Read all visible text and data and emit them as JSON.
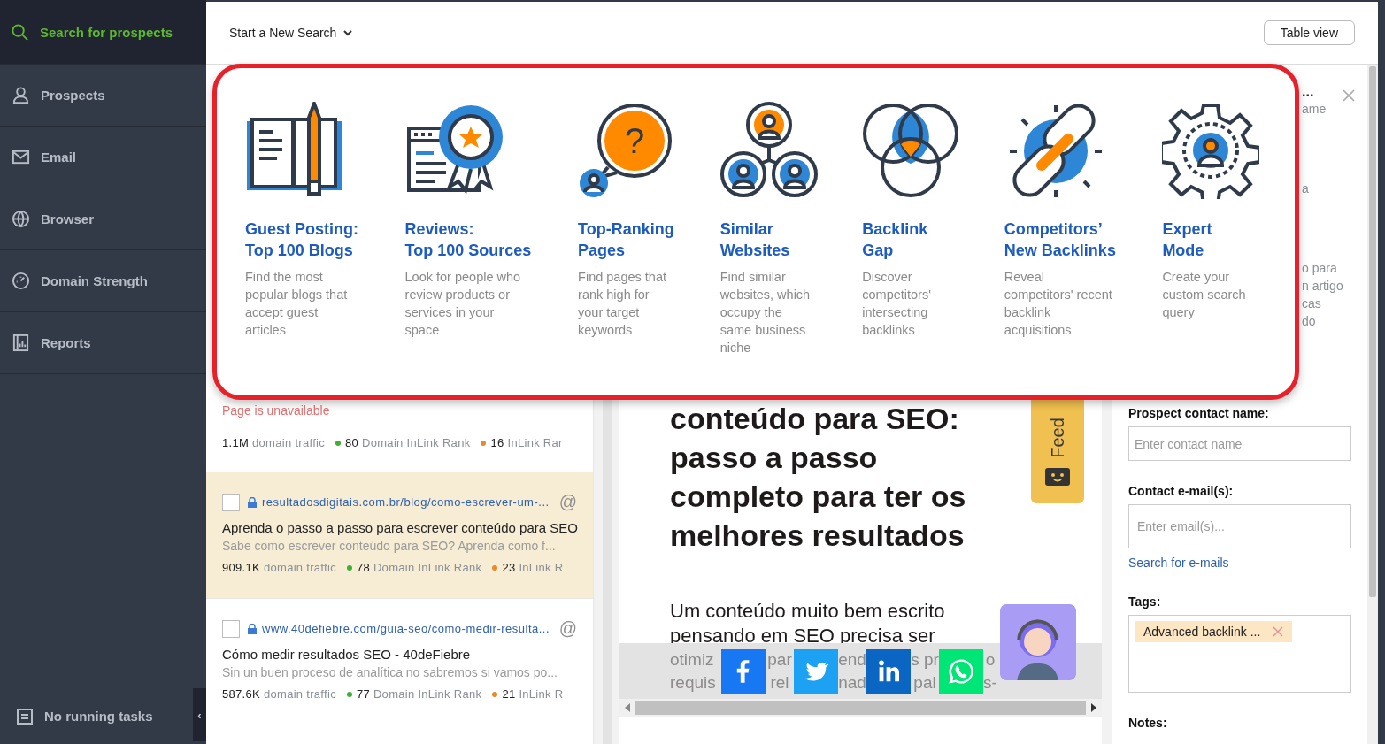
{
  "sidebar": {
    "items": [
      {
        "label": "Search for prospects",
        "selected": true
      },
      {
        "label": "Prospects",
        "selected": false
      },
      {
        "label": "Email",
        "selected": false
      },
      {
        "label": "Browser",
        "selected": false
      },
      {
        "label": "Domain Strength",
        "selected": false
      },
      {
        "label": "Reports",
        "selected": false
      }
    ],
    "tasks": "No running tasks",
    "collapse": "‹"
  },
  "toolbar": {
    "search_menu": "Start a New Search",
    "view_button": "Table view"
  },
  "popup": {
    "cards": [
      {
        "title": [
          "Guest Posting:",
          "Top 100 Blogs"
        ],
        "description": [
          "Find the most",
          "popular blogs that",
          "accept guest",
          "articles"
        ]
      },
      {
        "title": [
          "Reviews:",
          "Top 100 Sources"
        ],
        "description": [
          "Look for people who",
          "review products or",
          "services in your",
          "space"
        ]
      },
      {
        "icon_glyph": "?",
        "title": [
          "Top-Ranking",
          "Pages"
        ],
        "description": [
          "Find pages that",
          "rank high for",
          "your target",
          "keywords"
        ]
      },
      {
        "title": [
          "Similar",
          "Websites"
        ],
        "description": [
          "Find similar",
          "websites, which",
          "occupy the",
          "same business",
          "niche"
        ]
      },
      {
        "title": [
          "Backlink",
          "Gap"
        ],
        "description": [
          "Discover",
          "competitors'",
          "intersecting",
          "backlinks"
        ]
      },
      {
        "title": [
          "Competitors’",
          "New Backlinks"
        ],
        "description": [
          "Reveal",
          "competitors' recent",
          "backlink",
          "acquisitions"
        ]
      },
      {
        "title": [
          "Expert",
          "Mode"
        ],
        "description": [
          "Create your",
          "custom search",
          "query"
        ]
      }
    ]
  },
  "results": {
    "first": {
      "error": "Page is unavailable",
      "metrics": [
        {
          "figure": "1.1M",
          "caption": "domain traffic"
        },
        {
          "color": "#3cb034",
          "figure": "80",
          "caption": "Domain InLink Rank"
        },
        {
          "color": "#e8892b",
          "figure": "16",
          "caption": "InLink Rar"
        }
      ]
    },
    "items": [
      {
        "checked": false,
        "highlighted": true,
        "url": "resultadosdigitais.com.br/blog/como-escrever-um-...",
        "at": "@",
        "title": "Aprenda o passo a passo para escrever conteúdo para SEO",
        "snippet": "Sabe como escrever conteúdo para SEO? Aprenda como f...",
        "metrics": [
          {
            "figure": "909.1K",
            "caption": "domain traffic"
          },
          {
            "color": "#3cb034",
            "figure": "78",
            "caption": "Domain InLink Rank"
          },
          {
            "color": "#e8892b",
            "figure": "23",
            "caption": "InLink R"
          }
        ]
      },
      {
        "checked": false,
        "highlighted": false,
        "url": "www.40defiebre.com/guia-seo/como-medir-resulta...",
        "at": "@",
        "title": "Cómo medir resultados SEO - 40deFiebre",
        "snippet": "Sin un buen proceso de analítica no sabremos si vamos po...",
        "metrics": [
          {
            "figure": "587.6K",
            "caption": "domain traffic"
          },
          {
            "color": "#3cb034",
            "figure": "77",
            "caption": "Domain InLink Rank"
          },
          {
            "color": "#e8892b",
            "figure": "21",
            "caption": "InLink R"
          }
        ]
      }
    ]
  },
  "preview": {
    "heading": [
      "conteúdo para SEO:",
      "passo a passo",
      "completo para ter os",
      "melhores resultados"
    ],
    "paragraph": [
      "Um conteúdo muito bem escrito",
      "pensando em SEO precisa ser"
    ],
    "faded_columns": [
      [
        "otimiz",
        "requis"
      ],
      [
        "par",
        "rel"
      ],
      [
        "end",
        "nad"
      ],
      [
        "s pr",
        "pal"
      ],
      [
        "o",
        "s-"
      ]
    ],
    "share_buttons": [
      {
        "kind": "facebook"
      },
      {
        "kind": "twitter"
      },
      {
        "kind": "linkedin"
      },
      {
        "kind": "whatsapp"
      }
    ],
    "feedback": "Feed"
  },
  "details": {
    "title": "...",
    "peek_lines": [
      "ame",
      "a"
    ],
    "peek_paragraph": [
      "o para",
      "n artigo",
      "cas",
      "do"
    ],
    "contact_label": "Prospect contact name:",
    "contact_placeholder": "Enter contact name",
    "email_label": "Contact e-mail(s):",
    "email_placeholder": "Enter email(s)...",
    "email_link": "Search for e-mails",
    "tags_label": "Tags:",
    "tags": [
      "Advanced backlink ..."
    ],
    "notes_label": "Notes:"
  }
}
